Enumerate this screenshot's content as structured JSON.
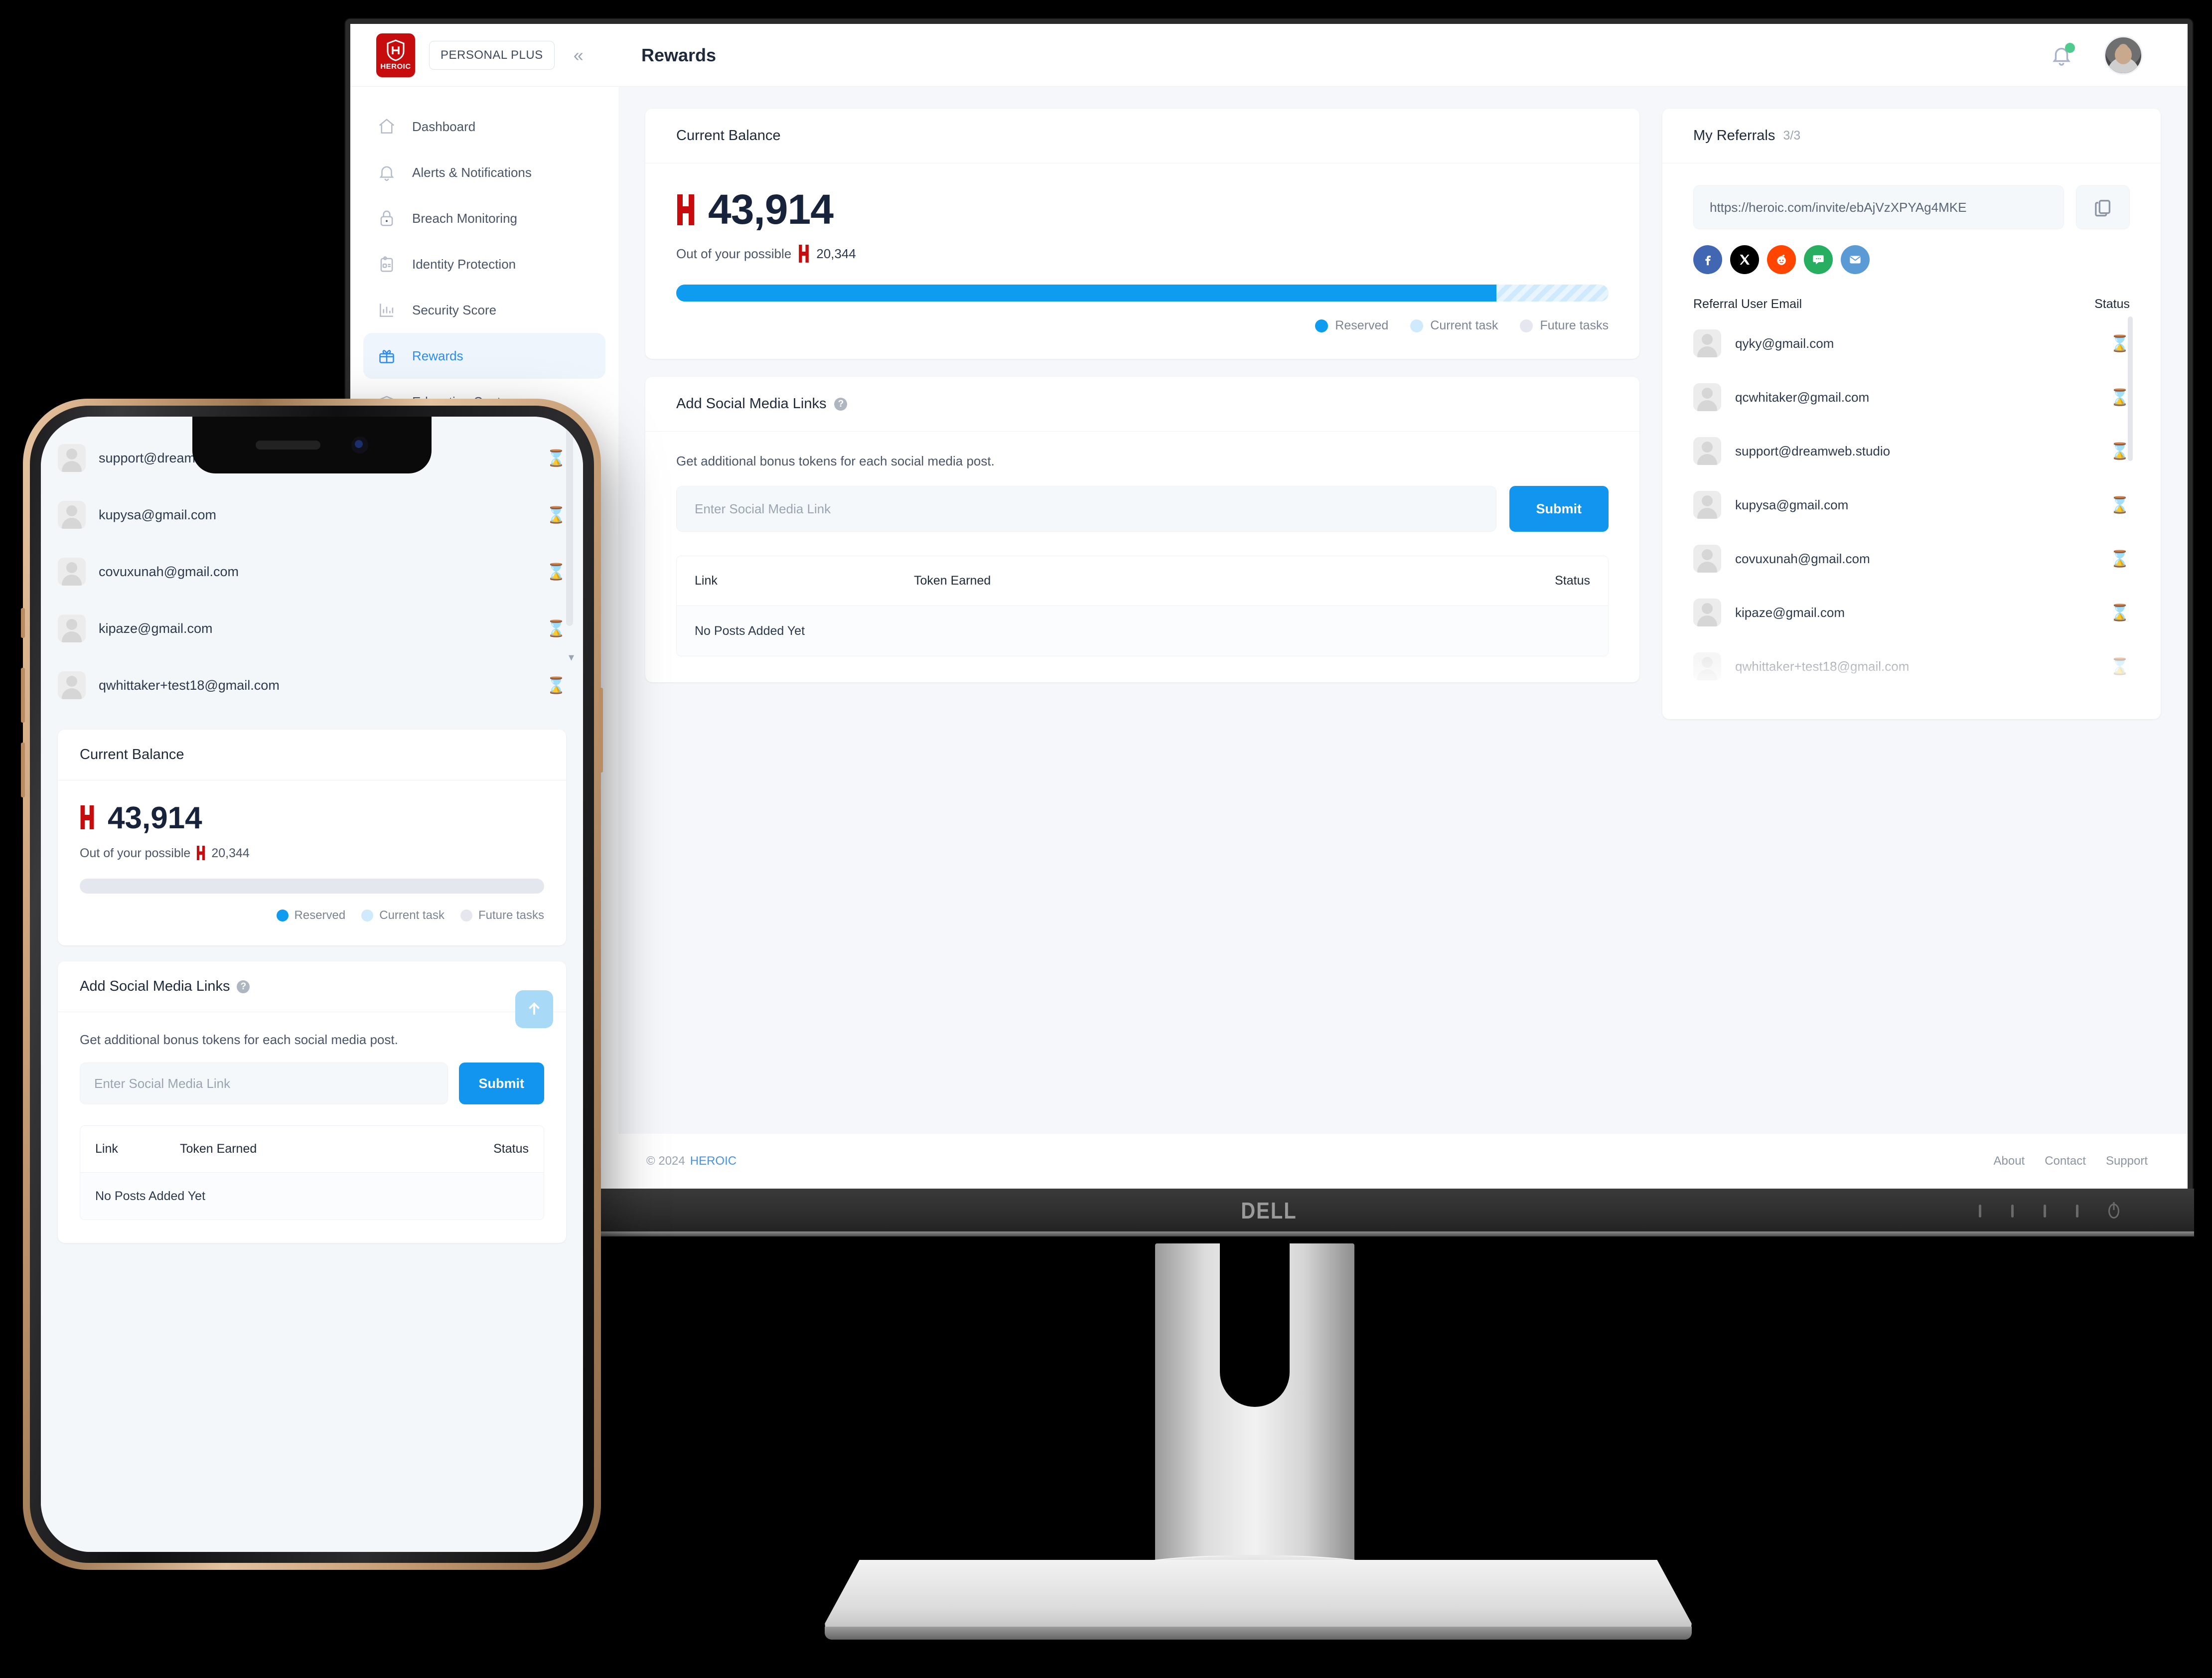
{
  "colors": {
    "brand_red": "#c60c0c",
    "accent_blue": "#1195ef",
    "progress_reserved": "#0e9cf0",
    "progress_current": "#cfeafc",
    "progress_future": "#e4e8ee",
    "active_nav": "#2f8bf0"
  },
  "brand": {
    "name": "HEROIC",
    "plan": "PERSONAL PLUS"
  },
  "sidebar": {
    "collapse_icon": "chevron-double-left-icon",
    "items": [
      {
        "label": "Dashboard",
        "icon": "home-icon",
        "active": false
      },
      {
        "label": "Alerts & Notifications",
        "icon": "bell-icon",
        "active": false
      },
      {
        "label": "Breach Monitoring",
        "icon": "lock-icon",
        "active": false
      },
      {
        "label": "Identity Protection",
        "icon": "id-card-icon",
        "active": false
      },
      {
        "label": "Security Score",
        "icon": "bar-chart-icon",
        "active": false
      },
      {
        "label": "Rewards",
        "icon": "gift-icon",
        "active": true
      },
      {
        "label": "Education Center",
        "icon": "graduation-cap-icon",
        "active": false
      }
    ]
  },
  "topbar": {
    "title": "Rewards",
    "bell_icon": "bell-icon",
    "has_notification": true,
    "avatar_icon": "user-avatar"
  },
  "balance_card": {
    "title": "Current Balance",
    "amount": "43,914",
    "token_icon": "heroic-token-icon",
    "possible_prefix": "Out of your possible",
    "possible_amount": "20,344",
    "progress": {
      "reserved_pct": 88,
      "current_pct": 12,
      "future_pct": 0
    },
    "legend": [
      {
        "label": "Reserved",
        "color": "#0e9cf0"
      },
      {
        "label": "Current task",
        "color": "#cfeafc"
      },
      {
        "label": "Future tasks",
        "color": "#e4e8ee"
      }
    ]
  },
  "social_card": {
    "title": "Add Social Media Links",
    "help_icon": "question-mark-icon",
    "hint": "Get additional bonus tokens for each social media post.",
    "input_placeholder": "Enter Social Media Link",
    "input_value": "",
    "submit_label": "Submit",
    "table": {
      "columns": [
        "Link",
        "Token Earned",
        "Status"
      ],
      "empty_message": "No Posts Added Yet"
    }
  },
  "referrals_card": {
    "title": "My Referrals",
    "count": "3/3",
    "invite_url": "https://heroic.com/invite/ebAjVzXPYAg4MKE",
    "copy_icon": "copy-icon",
    "share_buttons": [
      {
        "name": "facebook-share-icon",
        "color": "#4267B2"
      },
      {
        "name": "x-twitter-share-icon",
        "color": "#000000"
      },
      {
        "name": "reddit-share-icon",
        "color": "#FF4500"
      },
      {
        "name": "sms-share-icon",
        "color": "#27ae60"
      },
      {
        "name": "email-share-icon",
        "color": "#5b9bd5"
      }
    ],
    "columns": {
      "email": "Referral User Email",
      "status": "Status"
    },
    "rows": [
      {
        "email": "qyky@gmail.com",
        "status_icon": "hourglass-icon"
      },
      {
        "email": "qcwhitaker@gmail.com",
        "status_icon": "hourglass-icon"
      },
      {
        "email": "support@dreamweb.studio",
        "status_icon": "hourglass-icon"
      },
      {
        "email": "kupysa@gmail.com",
        "status_icon": "hourglass-icon"
      },
      {
        "email": "covuxunah@gmail.com",
        "status_icon": "hourglass-icon"
      },
      {
        "email": "kipaze@gmail.com",
        "status_icon": "hourglass-icon"
      },
      {
        "email": "qwhittaker+test18@gmail.com",
        "status_icon": "hourglass-icon"
      }
    ]
  },
  "footer": {
    "copyright": "© 2024",
    "brand": "HEROIC",
    "links": [
      "About",
      "Contact",
      "Support"
    ]
  },
  "phone": {
    "referral_rows": [
      {
        "email": "support@dreamweb.studio",
        "status_icon": "hourglass-icon"
      },
      {
        "email": "kupysa@gmail.com",
        "status_icon": "hourglass-icon"
      },
      {
        "email": "covuxunah@gmail.com",
        "status_icon": "hourglass-icon"
      },
      {
        "email": "kipaze@gmail.com",
        "status_icon": "hourglass-icon"
      },
      {
        "email": "qwhittaker+test18@gmail.com",
        "status_icon": "hourglass-icon"
      }
    ],
    "balance_card": {
      "title": "Current Balance",
      "amount": "43,914",
      "possible_prefix": "Out of your possible",
      "possible_amount": "20,344",
      "legend": [
        {
          "label": "Reserved",
          "color": "#0e9cf0"
        },
        {
          "label": "Current task",
          "color": "#cfeafc"
        },
        {
          "label": "Future tasks",
          "color": "#e4e8ee"
        }
      ]
    },
    "social_card": {
      "title": "Add Social Media Links",
      "hint": "Get additional bonus tokens for each social media post.",
      "input_placeholder": "Enter Social Media Link",
      "submit_label": "Submit",
      "columns": [
        "Link",
        "Token Earned",
        "Status"
      ],
      "empty_message": "No Posts Added Yet",
      "scroll_top_icon": "arrow-up-icon"
    }
  },
  "hardware": {
    "monitor_brand": "DELL"
  }
}
